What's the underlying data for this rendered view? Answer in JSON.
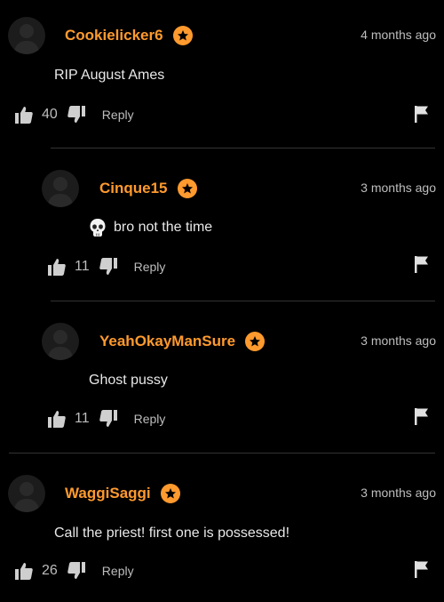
{
  "colors": {
    "background": "#000000",
    "username": "#ff9a2e",
    "text": "#e8e8e8",
    "muted": "#bdbdbd",
    "divider": "#333333"
  },
  "comments": [
    {
      "username": "Cookielicker6",
      "badge_icon": "star-badge-icon",
      "timestamp": "4 months ago",
      "text": "RIP August Ames",
      "likes": "40",
      "reply_label": "Reply",
      "is_reply": false
    },
    {
      "username": "Cinque15",
      "badge_icon": "star-badge-icon",
      "timestamp": "3 months ago",
      "emoji_icon": "skull-icon",
      "text": "bro not the time",
      "likes": "11",
      "reply_label": "Reply",
      "is_reply": true
    },
    {
      "username": "YeahOkayManSure",
      "badge_icon": "star-badge-icon",
      "timestamp": "3 months ago",
      "text": "Ghost pussy",
      "likes": "11",
      "reply_label": "Reply",
      "is_reply": true
    },
    {
      "username": "WaggiSaggi",
      "badge_icon": "star-badge-icon",
      "timestamp": "3 months ago",
      "text": "Call the priest! first one is possessed!",
      "likes": "26",
      "reply_label": "Reply",
      "is_reply": false
    }
  ]
}
